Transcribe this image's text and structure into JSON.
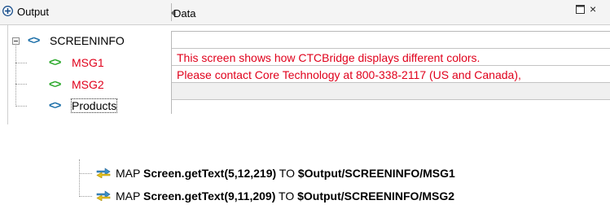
{
  "header": {
    "output_label": "Output",
    "data_label": "Data",
    "close_glyph": "×"
  },
  "tree": {
    "root": "SCREENINFO",
    "children": [
      {
        "label": "MSG1",
        "value": "This screen shows how CTCBridge displays different colors."
      },
      {
        "label": "MSG2",
        "value": " Please contact Core Technology at 800-338-2117 (US and Canada),"
      },
      {
        "label": "Products",
        "value": ""
      }
    ]
  },
  "mappings": [
    {
      "keyword": "MAP",
      "source": "Screen.getText(5,12,219)",
      "to": "TO",
      "target": "$Output/SCREENINFO/MSG1"
    },
    {
      "keyword": "MAP",
      "source": "Screen.getText(9,11,209)",
      "to": "TO",
      "target": "$Output/SCREENINFO/MSG2"
    }
  ],
  "colors": {
    "value_text": "#e0001b",
    "label_red": "#e0001b",
    "tag_blue": "#1a6ea8",
    "tag_green": "#2aa82a"
  }
}
